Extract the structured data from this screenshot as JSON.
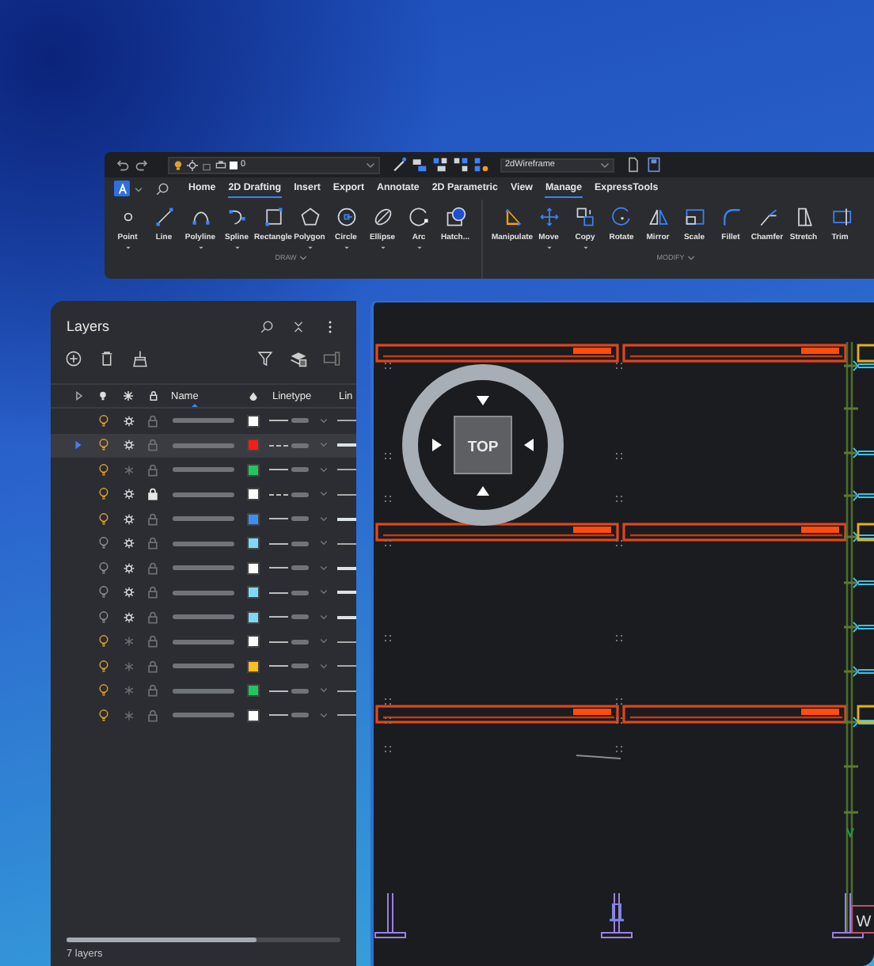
{
  "quick_access": {
    "layer": "0",
    "visual_style": "2dWireframe"
  },
  "ribbon": {
    "tabs": [
      {
        "label": "Home",
        "selected": false
      },
      {
        "label": "2D Drafting",
        "selected": true
      },
      {
        "label": "Insert",
        "selected": false
      },
      {
        "label": "Export",
        "selected": false
      },
      {
        "label": "Annotate",
        "selected": false
      },
      {
        "label": "2D Parametric",
        "selected": false
      },
      {
        "label": "View",
        "selected": false
      },
      {
        "label": "Manage",
        "selected": true
      },
      {
        "label": "ExpressTools",
        "selected": false
      }
    ],
    "groups": [
      {
        "label": "DRAW",
        "tools": [
          {
            "label": "Point",
            "dropdown": true
          },
          {
            "label": "Line",
            "dropdown": false
          },
          {
            "label": "Polyline",
            "dropdown": true
          },
          {
            "label": "Spline",
            "dropdown": true
          },
          {
            "label": "Rectangle",
            "dropdown": false
          },
          {
            "label": "Polygon",
            "dropdown": true
          },
          {
            "label": "Circle",
            "dropdown": true
          },
          {
            "label": "Ellipse",
            "dropdown": true
          },
          {
            "label": "Arc",
            "dropdown": true
          },
          {
            "label": "Hatch...",
            "dropdown": false
          }
        ]
      },
      {
        "label": "MODIFY",
        "tools": [
          {
            "label": "Manipulate",
            "dropdown": false
          },
          {
            "label": "Move",
            "dropdown": true
          },
          {
            "label": "Copy",
            "dropdown": true
          },
          {
            "label": "Rotate",
            "dropdown": false
          },
          {
            "label": "Mirror",
            "dropdown": false
          },
          {
            "label": "Scale",
            "dropdown": false
          },
          {
            "label": "Fillet",
            "dropdown": false
          },
          {
            "label": "Chamfer",
            "dropdown": false
          },
          {
            "label": "Stretch",
            "dropdown": false
          },
          {
            "label": "Trim",
            "dropdown": false
          }
        ]
      }
    ]
  },
  "layers_panel": {
    "title": "Layers",
    "columns": [
      "Name",
      "Linetype",
      "Lin"
    ],
    "layers": [
      {
        "selected": false,
        "on": true,
        "frozen": false,
        "locked": false,
        "color": "#ffffff",
        "dashed": false,
        "thick": false
      },
      {
        "selected": true,
        "on": true,
        "frozen": false,
        "locked": false,
        "color": "#ff1a1a",
        "dashed": true,
        "thick": true
      },
      {
        "selected": false,
        "on": true,
        "frozen": true,
        "locked": false,
        "color": "#22c55e",
        "dashed": false,
        "thick": false
      },
      {
        "selected": false,
        "on": true,
        "frozen": false,
        "locked": true,
        "color": "#ffffff",
        "dashed": true,
        "thick": false
      },
      {
        "selected": false,
        "on": true,
        "frozen": false,
        "locked": false,
        "color": "#3b8ff0",
        "dashed": false,
        "thick": true
      },
      {
        "selected": false,
        "on": false,
        "frozen": false,
        "locked": false,
        "color": "#7dd8fb",
        "dashed": false,
        "thick": false
      },
      {
        "selected": false,
        "on": false,
        "frozen": false,
        "locked": false,
        "color": "#ffffff",
        "dashed": false,
        "thick": true
      },
      {
        "selected": false,
        "on": false,
        "frozen": false,
        "locked": false,
        "color": "#7dd8fb",
        "dashed": false,
        "thick": true
      },
      {
        "selected": false,
        "on": false,
        "frozen": false,
        "locked": false,
        "color": "#7dd8fb",
        "dashed": false,
        "thick": true
      },
      {
        "selected": false,
        "on": true,
        "frozen": true,
        "locked": false,
        "color": "#ffffff",
        "dashed": false,
        "thick": false
      },
      {
        "selected": false,
        "on": true,
        "frozen": true,
        "locked": false,
        "color": "#fbbf24",
        "dashed": false,
        "thick": false
      },
      {
        "selected": false,
        "on": true,
        "frozen": true,
        "locked": false,
        "color": "#22c55e",
        "dashed": false,
        "thick": false
      },
      {
        "selected": false,
        "on": true,
        "frozen": true,
        "locked": false,
        "color": "#ffffff",
        "dashed": false,
        "thick": false
      }
    ],
    "footer": "7 layers"
  },
  "canvas": {
    "view_label": "TOP",
    "grid_label": "W"
  }
}
